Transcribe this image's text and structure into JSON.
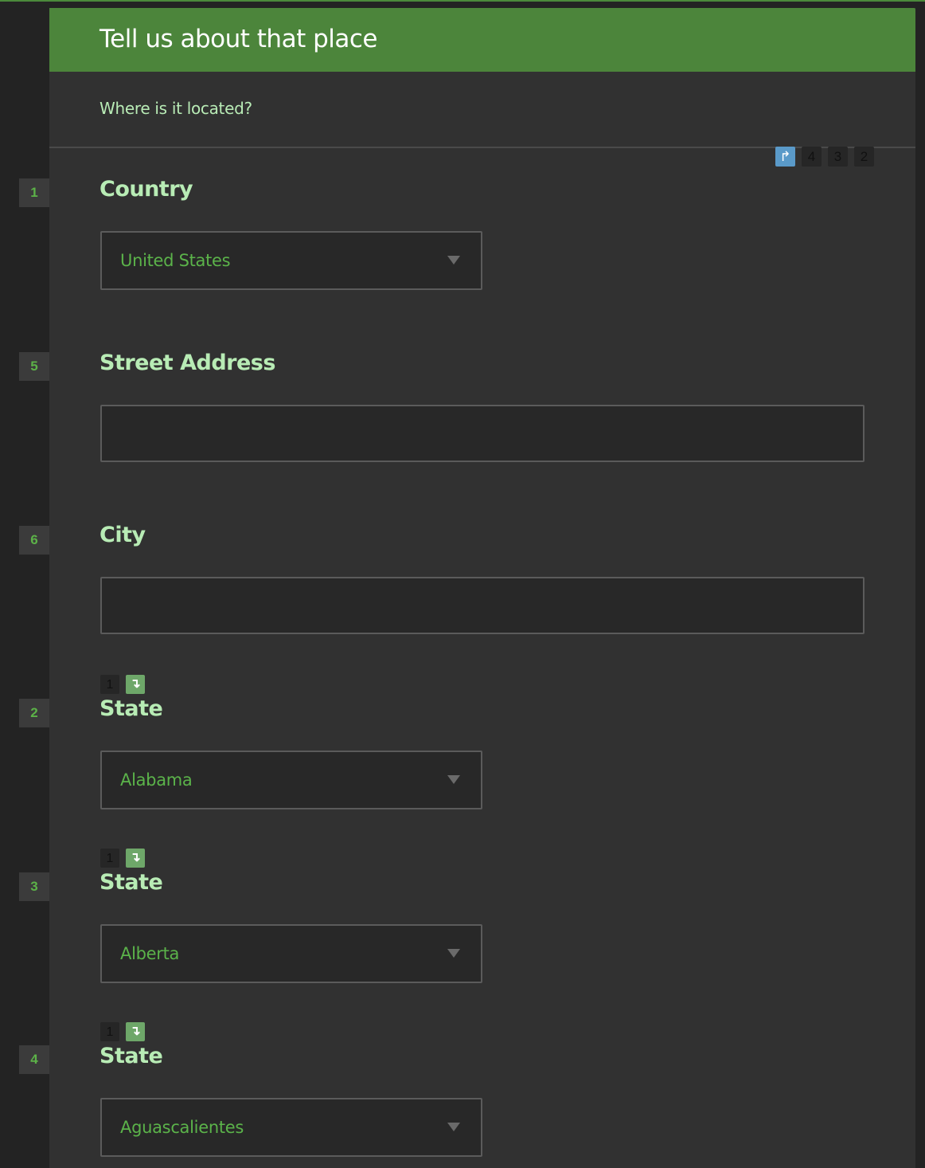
{
  "header": {
    "title": "Tell us about that place"
  },
  "subheader": {
    "text": "Where is it located?"
  },
  "sequence_badges": [
    {
      "type": "icon",
      "icon": "turn-right-arrow-icon",
      "glyph": "↱",
      "color": "#5a9ac9"
    },
    {
      "type": "number",
      "label": "4"
    },
    {
      "type": "number",
      "label": "3"
    },
    {
      "type": "number",
      "label": "2"
    }
  ],
  "dependency_icon": {
    "glyph": "↴",
    "color": "#6ea769"
  },
  "questions": [
    {
      "number": "1",
      "label": "Country",
      "type": "select",
      "value": "United States"
    },
    {
      "number": "5",
      "label": "Street Address",
      "type": "text",
      "value": ""
    },
    {
      "number": "6",
      "label": "City",
      "type": "text",
      "value": ""
    },
    {
      "number": "2",
      "label": "State",
      "type": "select",
      "value": "Alabama",
      "depends_on": "1"
    },
    {
      "number": "3",
      "label": "State",
      "type": "select",
      "value": "Alberta",
      "depends_on": "1"
    },
    {
      "number": "4",
      "label": "State",
      "type": "select",
      "value": "Aguascalientes",
      "depends_on": "1"
    }
  ],
  "colors": {
    "header_bg": "#4c853b",
    "label": "#b8ecb5",
    "value": "#5bb34a",
    "panel_bg": "#313131"
  }
}
